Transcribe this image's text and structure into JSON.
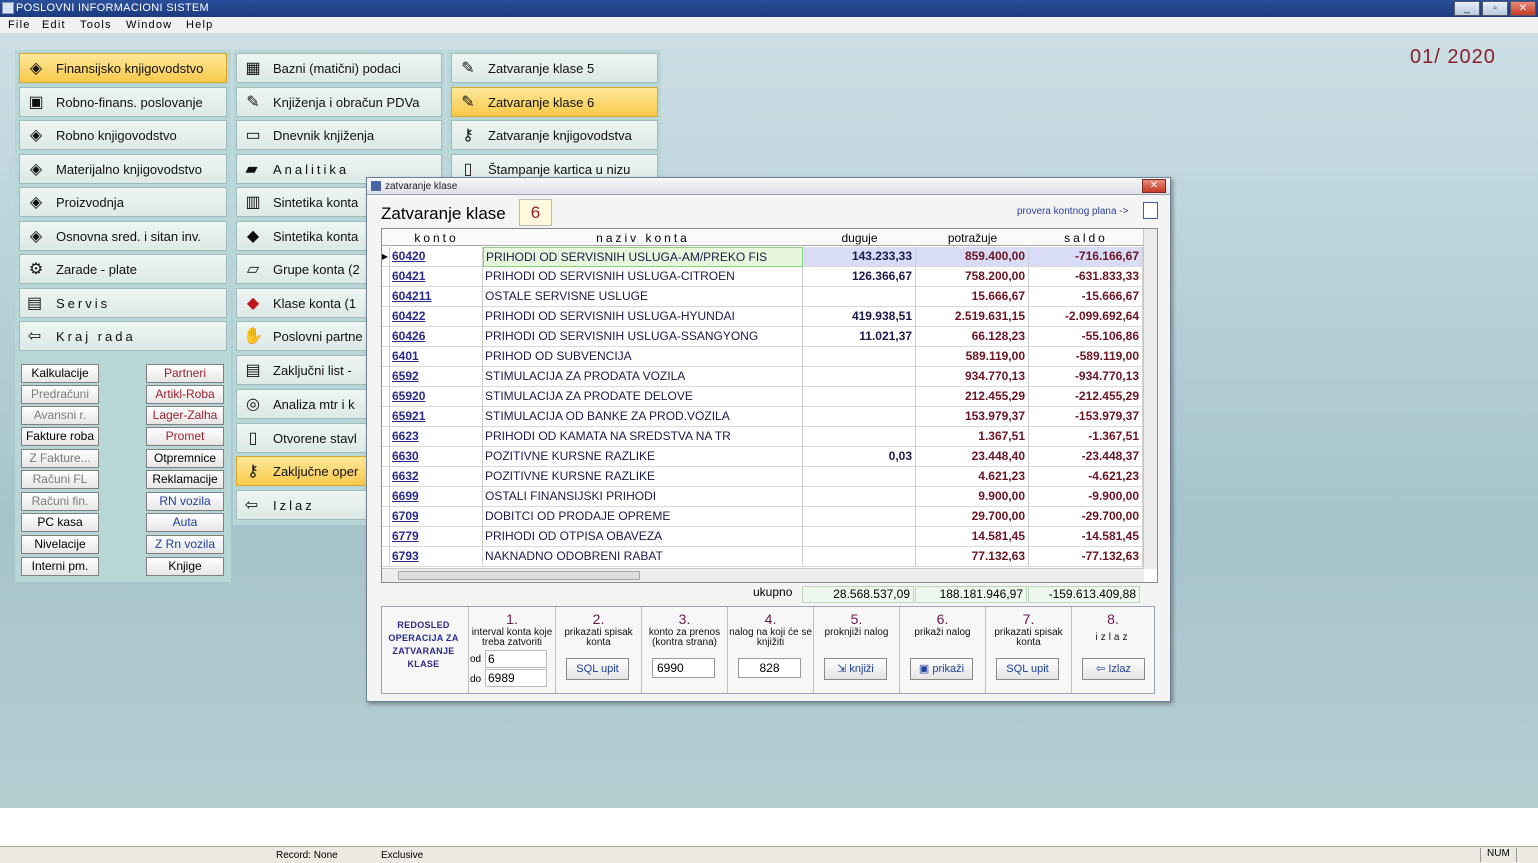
{
  "window": {
    "title": "POSLOVNI INFORMACIONI SISTEM"
  },
  "menubar": [
    "File",
    "Edit",
    "Tools",
    "Window",
    "Help"
  ],
  "period": "01/ 2020",
  "left_panel": [
    {
      "label": "Finansijsko knjigovodstvo",
      "icon": "diamond-icon",
      "active": true
    },
    {
      "label": "Robno-finans. poslovanje",
      "icon": "computer-icon",
      "active": false
    },
    {
      "label": "Robno knjigovodstvo",
      "icon": "diamond-icon",
      "active": false
    },
    {
      "label": "Materijalno knjigovodstvo",
      "icon": "diamond-icon",
      "active": false
    },
    {
      "label": "Proizvodnja",
      "icon": "diamond-icon",
      "active": false
    },
    {
      "label": "Osnovna sred. i sitan inv.",
      "icon": "diamond-icon",
      "active": false
    },
    {
      "label": "Zarade - plate",
      "icon": "wrench-icon",
      "active": false
    },
    {
      "label": "Servis",
      "icon": "printer-icon",
      "active": false
    },
    {
      "label": "Kraj rada",
      "icon": "exit-icon",
      "active": false
    }
  ],
  "small_buttons_left": [
    "Kalkulacije",
    "Predračuni",
    "Avansni r.",
    "Fakture roba",
    "Z Fakture...",
    "Računi FL",
    "Računi fin.",
    "PC kasa",
    "Nivelacije",
    "Interni pm."
  ],
  "small_buttons_right": [
    "Partneri",
    "Artikl-Roba",
    "Lager-Zalha",
    "Promet",
    "Otpremnice",
    "Reklamacije",
    "RN vozila",
    "Auta",
    "Z Rn vozila",
    "Knjige"
  ],
  "middle_panel": [
    {
      "label": "Bazni (matični) podaci"
    },
    {
      "label": "Knjiženja i obračun PDVa"
    },
    {
      "label": "Dnevnik knjiženja"
    },
    {
      "label": "Analitika"
    },
    {
      "label": "Sintetika konta"
    },
    {
      "label": "Sintetika konta"
    },
    {
      "label": "Grupe konta (2"
    },
    {
      "label": "Klase konta (1"
    },
    {
      "label": "Poslovni partne"
    },
    {
      "label": "Zaključni list -"
    },
    {
      "label": "Analiza mtr i k"
    },
    {
      "label": "Otvorene stavl"
    },
    {
      "label": "Zaključne oper"
    },
    {
      "label": "Izlaz"
    }
  ],
  "right_panel": [
    {
      "label": "Zatvaranje klase 5"
    },
    {
      "label": "Zatvaranje klase 6"
    },
    {
      "label": "Zatvaranje knjigovodstva"
    },
    {
      "label": "Štampanje kartica u nizu"
    }
  ],
  "dialog": {
    "title": "zatvaranje klase",
    "heading": "Zatvaranje klase",
    "class_value": "6",
    "link": "provera kontnog plana ->",
    "columns": [
      "konto",
      "naziv konta",
      "duguje",
      "potražuje",
      "saldo"
    ],
    "rows": [
      [
        "60420",
        "PRIHODI OD SERVISNIH USLUGA-AM/PREKO FIS",
        "143.233,33",
        "859.400,00",
        "-716.166,67"
      ],
      [
        "60421",
        "PRIHODI OD SERVISNIH USLUGA-CITROEN",
        "126.366,67",
        "758.200,00",
        "-631.833,33"
      ],
      [
        "604211",
        "OSTALE SERVISNE USLUGE",
        "",
        "15.666,67",
        "-15.666,67"
      ],
      [
        "60422",
        "PRIHODI OD SERVISNIH USLUGA-HYUNDAI",
        "419.938,51",
        "2.519.631,15",
        "-2.099.692,64"
      ],
      [
        "60426",
        "PRIHODI OD SERVISNIH USLUGA-SSANGYONG",
        "11.021,37",
        "66.128,23",
        "-55.106,86"
      ],
      [
        "6401",
        "PRIHOD OD SUBVENCIJA",
        "",
        "589.119,00",
        "-589.119,00"
      ],
      [
        "6592",
        "STIMULACIJA ZA PRODATA VOZILA",
        "",
        "934.770,13",
        "-934.770,13"
      ],
      [
        "65920",
        "STIMULACIJA ZA PRODATE DELOVE",
        "",
        "212.455,29",
        "-212.455,29"
      ],
      [
        "65921",
        "STIMULACIJA OD BANKE ZA PROD.VOZILA",
        "",
        "153.979,37",
        "-153.979,37"
      ],
      [
        "6623",
        "PRIHODI OD KAMATA NA SREDSTVA NA TR",
        "",
        "1.367,51",
        "-1.367,51"
      ],
      [
        "6630",
        "POZITIVNE KURSNE RAZLIKE",
        "0,03",
        "23.448,40",
        "-23.448,37"
      ],
      [
        "6632",
        "POZITIVNE KURSNE RAZLIKE",
        "",
        "4.621,23",
        "-4.621,23"
      ],
      [
        "6699",
        "OSTALI FINANSIJSKI PRIHODI",
        "",
        "9.900,00",
        "-9.900,00"
      ],
      [
        "6709",
        "DOBITCI OD PRODAJE OPREME",
        "",
        "29.700,00",
        "-29.700,00"
      ],
      [
        "6779",
        "PRIHODI OD OTPISA OBAVEZA",
        "",
        "14.581,45",
        "-14.581,45"
      ],
      [
        "6793",
        "NAKNADNO ODOBRENI RABAT",
        "",
        "77.132,63",
        "-77.132,63"
      ]
    ],
    "totals_label": "ukupno",
    "totals": [
      "28.568.537,09",
      "188.181.946,97",
      "-159.613.409,88"
    ],
    "redosled": "REDOSLED OPERACIJA ZA ZATVARANJE KLASE",
    "steps": [
      {
        "n": "1.",
        "label": "interval konta koje treba zatvoriti",
        "od_label": "od",
        "od": "6",
        "do_label": "do",
        "do": "6989"
      },
      {
        "n": "2.",
        "label": "prikazati spisak konta",
        "button": "SQL upit"
      },
      {
        "n": "3.",
        "label": "konto za prenos (kontra strana)",
        "value": "6990"
      },
      {
        "n": "4.",
        "label": "nalog na koji će se knjižiti",
        "value": "828"
      },
      {
        "n": "5.",
        "label": "proknjiži nalog",
        "button": "knjiži"
      },
      {
        "n": "6.",
        "label": "prikaži nalog",
        "button": "prikaži"
      },
      {
        "n": "7.",
        "label": "prikazati spisak konta",
        "button": "SQL upit"
      },
      {
        "n": "8.",
        "label": "izlaz",
        "button": "Izlaz"
      }
    ]
  },
  "statusbar": {
    "record": "Record: None",
    "mode": "Exclusive",
    "num": "NUM"
  }
}
